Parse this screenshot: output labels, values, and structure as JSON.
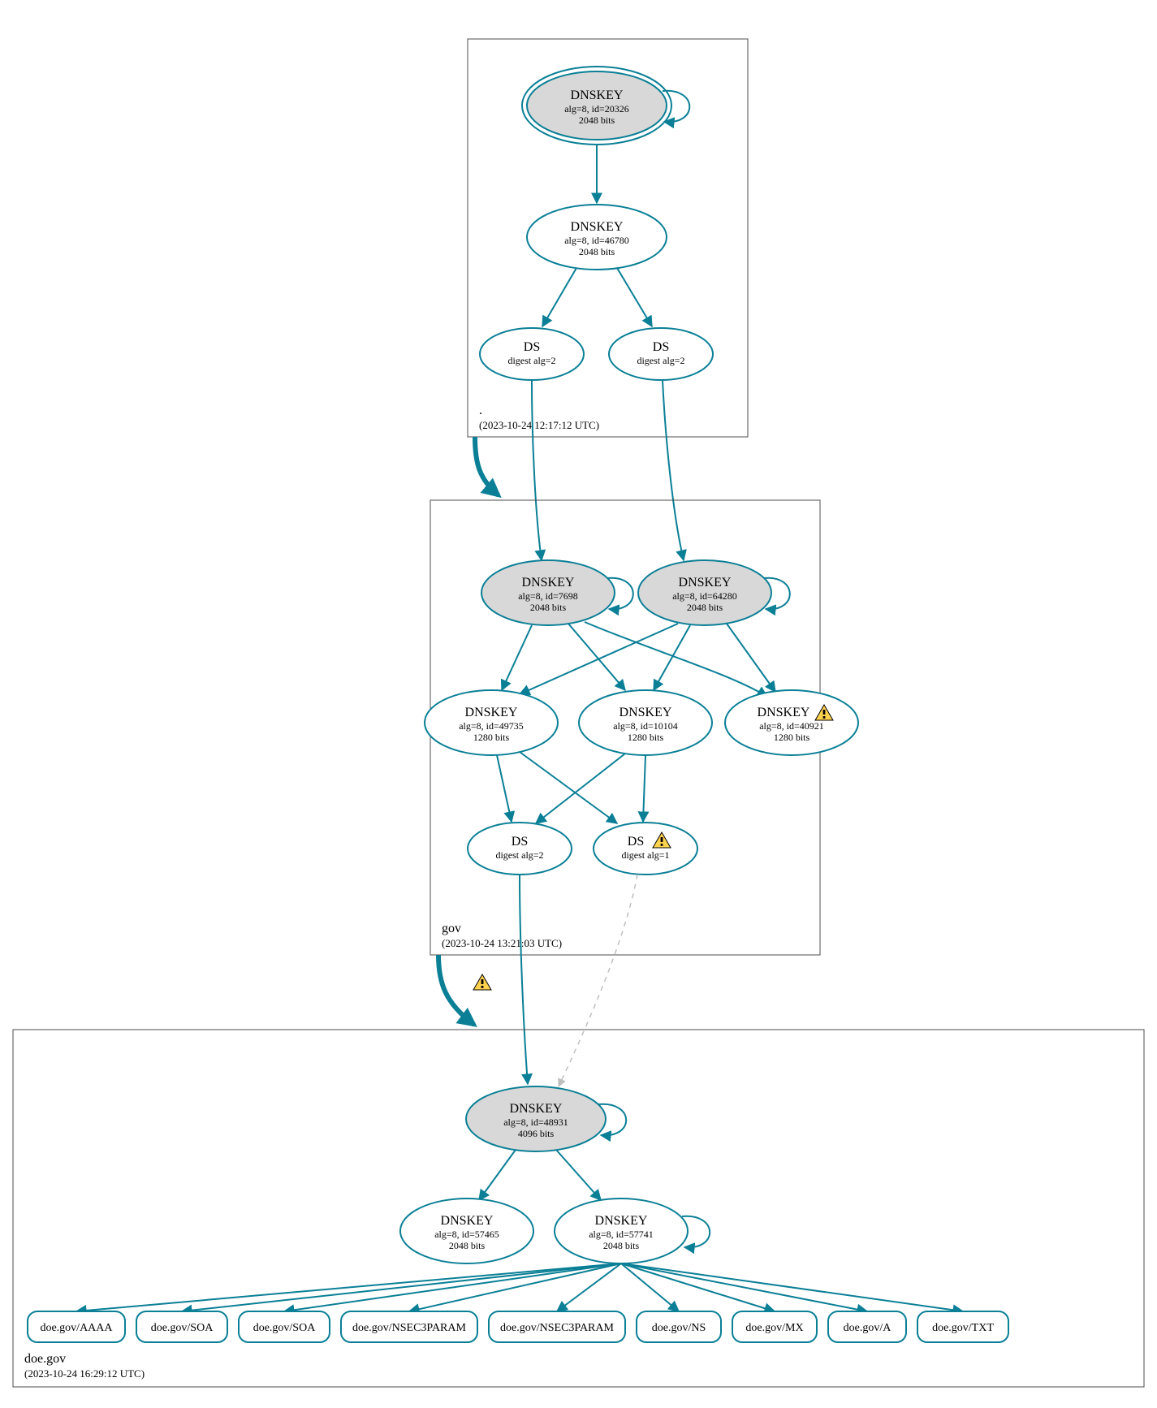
{
  "zones": {
    "root": {
      "name": ".",
      "time": "(2023-10-24 12:17:12 UTC)"
    },
    "gov": {
      "name": "gov",
      "time": "(2023-10-24 13:21:03 UTC)"
    },
    "doe": {
      "name": "doe.gov",
      "time": "(2023-10-24 16:29:12 UTC)"
    }
  },
  "nodes": {
    "root_ksk": {
      "title": "DNSKEY",
      "sub1": "alg=8, id=20326",
      "sub2": "2048 bits"
    },
    "root_zsk": {
      "title": "DNSKEY",
      "sub1": "alg=8, id=46780",
      "sub2": "2048 bits"
    },
    "root_ds1": {
      "title": "DS",
      "sub1": "digest alg=2"
    },
    "root_ds2": {
      "title": "DS",
      "sub1": "digest alg=2"
    },
    "gov_ksk1": {
      "title": "DNSKEY",
      "sub1": "alg=8, id=7698",
      "sub2": "2048 bits"
    },
    "gov_ksk2": {
      "title": "DNSKEY",
      "sub1": "alg=8, id=64280",
      "sub2": "2048 bits"
    },
    "gov_zsk1": {
      "title": "DNSKEY",
      "sub1": "alg=8, id=49735",
      "sub2": "1280 bits"
    },
    "gov_zsk2": {
      "title": "DNSKEY",
      "sub1": "alg=8, id=10104",
      "sub2": "1280 bits"
    },
    "gov_zsk3": {
      "title": "DNSKEY",
      "sub1": "alg=8, id=40921",
      "sub2": "1280 bits"
    },
    "gov_ds1": {
      "title": "DS",
      "sub1": "digest alg=2"
    },
    "gov_ds2": {
      "title": "DS",
      "sub1": "digest alg=1"
    },
    "doe_ksk": {
      "title": "DNSKEY",
      "sub1": "alg=8, id=48931",
      "sub2": "4096 bits"
    },
    "doe_zsk1": {
      "title": "DNSKEY",
      "sub1": "alg=8, id=57465",
      "sub2": "2048 bits"
    },
    "doe_zsk2": {
      "title": "DNSKEY",
      "sub1": "alg=8, id=57741",
      "sub2": "2048 bits"
    }
  },
  "rrsets": [
    "doe.gov/AAAA",
    "doe.gov/SOA",
    "doe.gov/SOA",
    "doe.gov/NSEC3PARAM",
    "doe.gov/NSEC3PARAM",
    "doe.gov/NS",
    "doe.gov/MX",
    "doe.gov/A",
    "doe.gov/TXT"
  ]
}
